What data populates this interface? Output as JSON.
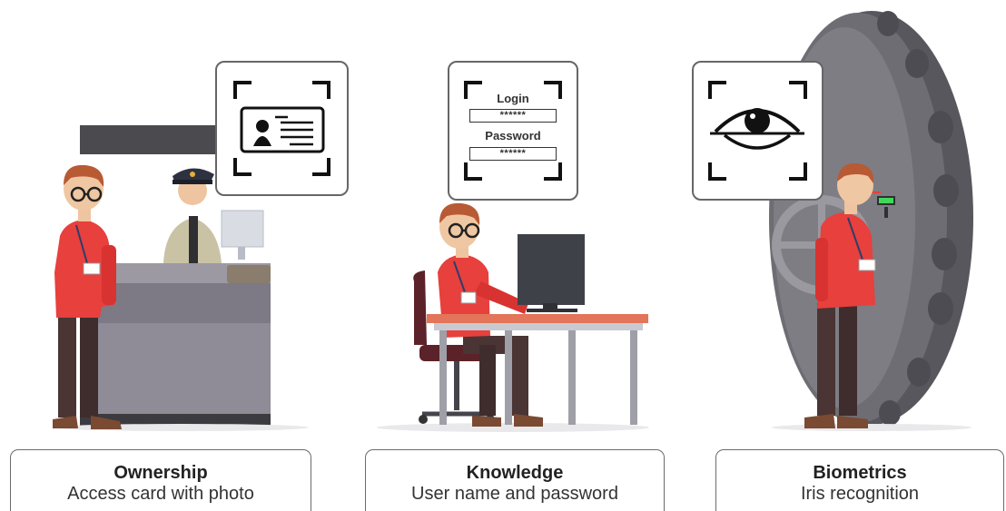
{
  "colors": {
    "shirt": "#e7403d",
    "vault": "#6e6d73",
    "desk_top": "#e2755a",
    "counter": "#7d7a86"
  },
  "panels": [
    {
      "title": "Ownership",
      "subtitle": "Access card with photo",
      "icon": "id-card-icon"
    },
    {
      "title": "Knowledge",
      "subtitle": "User name and password",
      "icon": "login-form-icon"
    },
    {
      "title": "Biometrics",
      "subtitle": "Iris recognition",
      "icon": "eye-icon"
    }
  ],
  "login_form": {
    "login_label": "Login",
    "login_value": "******",
    "password_label": "Password",
    "password_value": "******"
  }
}
